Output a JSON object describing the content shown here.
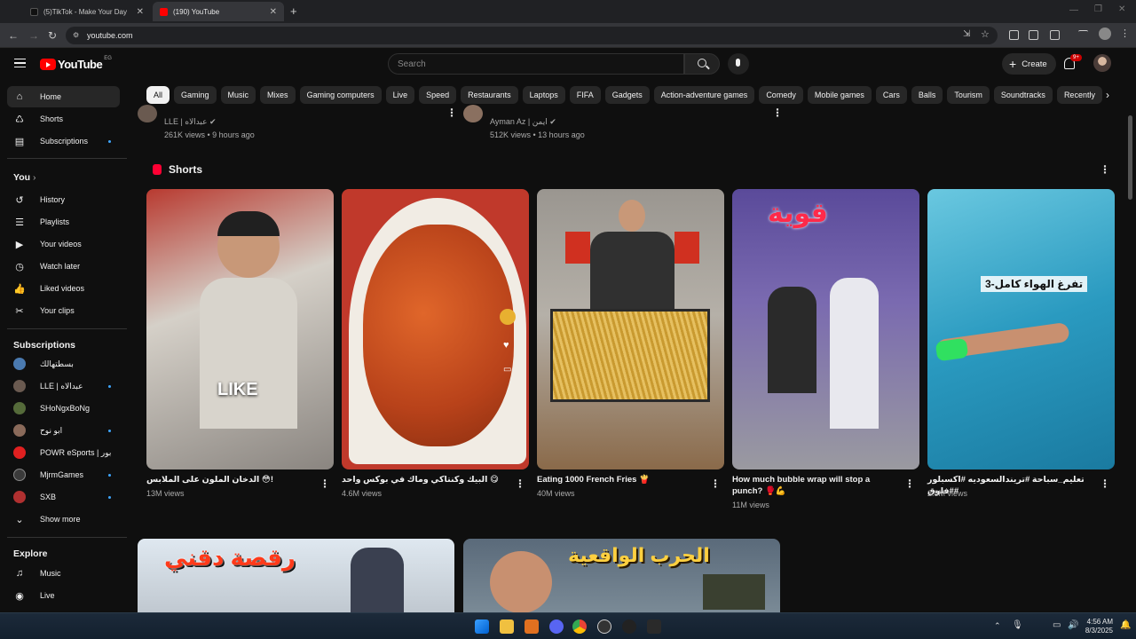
{
  "browser": {
    "tabs": [
      {
        "title": "(5)TikTok - Make Your Day",
        "active": false
      },
      {
        "title": "(190) YouTube",
        "active": true
      }
    ],
    "url": "youtube.com"
  },
  "header": {
    "logo_text": "YouTube",
    "country_code": "EG",
    "search_placeholder": "Search",
    "create_label": "Create",
    "notifications_badge": "9+"
  },
  "sidebar": {
    "main": [
      {
        "label": "Home",
        "icon": "home-icon"
      },
      {
        "label": "Shorts",
        "icon": "shorts-icon"
      },
      {
        "label": "Subscriptions",
        "icon": "subscriptions-icon"
      }
    ],
    "you_heading": "You",
    "you_items": [
      {
        "label": "History"
      },
      {
        "label": "Playlists"
      },
      {
        "label": "Your videos"
      },
      {
        "label": "Watch later"
      },
      {
        "label": "Liked videos"
      },
      {
        "label": "Your clips"
      }
    ],
    "subscriptions_heading": "Subscriptions",
    "subscriptions": [
      {
        "label": "بسطتهالك",
        "color": "#4a7ab0"
      },
      {
        "label": "LLE | عبدالاه",
        "color": "#6a5a50"
      },
      {
        "label": "SHoNgxBoNg",
        "color": "#556b3a"
      },
      {
        "label": "ابو نوح",
        "color": "#8a6a5a"
      },
      {
        "label": "POWR eSports | بور",
        "color": "#e02020"
      },
      {
        "label": "MjrmGames",
        "color": "#3a3a3a"
      },
      {
        "label": "SXB",
        "color": "#b03030"
      }
    ],
    "show_more": "Show more",
    "explore_heading": "Explore",
    "explore": [
      {
        "label": "Music"
      },
      {
        "label": "Live"
      }
    ]
  },
  "chips": [
    "All",
    "Gaming",
    "Music",
    "Mixes",
    "Gaming computers",
    "Live",
    "Speed",
    "Restaurants",
    "Laptops",
    "FIFA",
    "Gadgets",
    "Action-adventure games",
    "Comedy",
    "Mobile games",
    "Cars",
    "Balls",
    "Tourism",
    "Soundtracks",
    "Recently"
  ],
  "top_videos": [
    {
      "channel": "LLE | عبدالاه",
      "meta": "261K views • 9 hours ago"
    },
    {
      "channel": "Ayman Az | ايمن",
      "meta": "512K views • 13 hours ago"
    }
  ],
  "shorts": {
    "heading": "Shorts",
    "items": [
      {
        "title": "الدخان الملون على الملابس 😳!",
        "views": "13M views",
        "overlay": "LIKE"
      },
      {
        "title": "البيك وكنتاكي وماك في بوكس واحد 😋",
        "views": "4.6M views"
      },
      {
        "title": "Eating 1000 French Fries 🍟",
        "views": "40M views"
      },
      {
        "title": "How much bubble wrap will stop a punch? 🥊💪",
        "views": "11M views",
        "overlay": "قوية"
      },
      {
        "title": "تعليم_سباحة #تريندالسعوديه #اكسبلور #فلوق#",
        "views": "2.8M views",
        "overlay": "3-تفرغ الهواء كامل"
      }
    ]
  },
  "bottom_thumbs": [
    {
      "overlay": "رقصة دقني"
    },
    {
      "overlay": "الحرب الواقعية"
    }
  ],
  "taskbar": {
    "time": "4:56 AM",
    "date": "8/3/2025"
  }
}
